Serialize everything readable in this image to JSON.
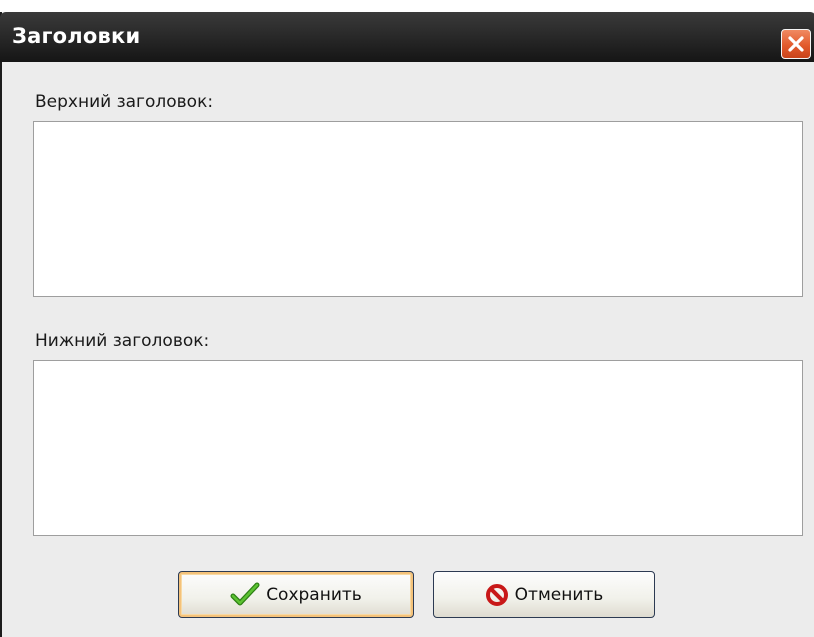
{
  "window": {
    "title": "Заголовки",
    "close_icon": "close-icon"
  },
  "top_header": {
    "label": "Верхний заголовок:",
    "value": ""
  },
  "bottom_header": {
    "label": "Нижний заголовок:",
    "value": ""
  },
  "buttons": {
    "save_label": "Сохранить",
    "save_icon": "checkmark-icon",
    "cancel_label": "Отменить",
    "cancel_icon": "no-entry-icon"
  },
  "colors": {
    "titlebar": "#2a2a2a",
    "close_button": "#e25a2c",
    "dialog_background": "#ececec",
    "save_check": "#3a9a1e",
    "cancel_sign": "#d21c1c"
  }
}
